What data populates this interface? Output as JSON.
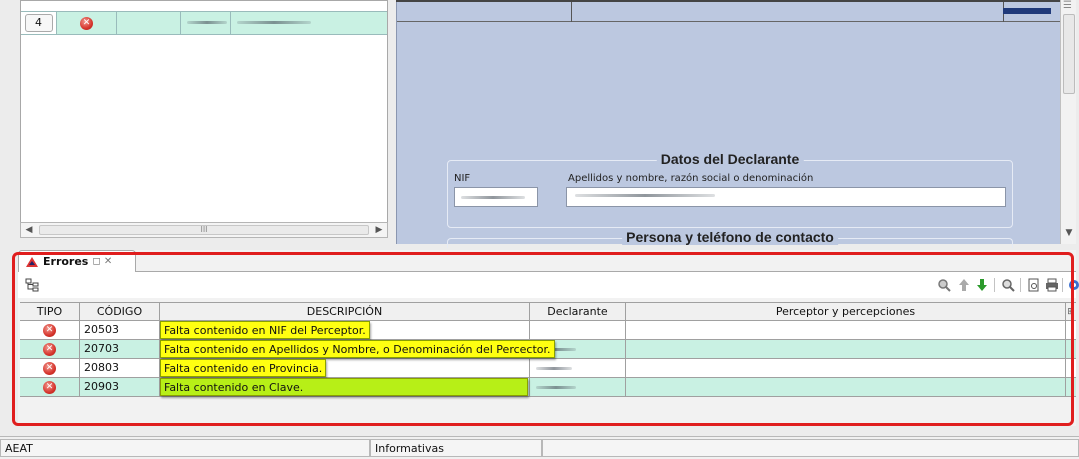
{
  "left_table": {
    "row_number": "4",
    "row_icon": "error-circle-icon",
    "hscroll_glyph": "III",
    "left_arrow": "◀",
    "right_arrow": "▶"
  },
  "form": {
    "section_title": "Datos del Declarante",
    "nif_label": "NIF",
    "name_label": "Apellidos y nombre, razón social o denominación",
    "next_section_title": "Persona y teléfono de contacto"
  },
  "errors_panel": {
    "tab_label": "Errores",
    "tab_extra": "◻ ✕",
    "tree_icon": "tree-icon",
    "toolbar_icons": [
      "search-icon",
      "arrow-up-icon",
      "arrow-down-icon",
      "zoom-icon",
      "preview-icon",
      "print-icon",
      "help-icon"
    ],
    "columns": [
      "TIPO",
      "CÓDIGO",
      "DESCRIPCIÓN",
      "Declarante",
      "Perceptor y percepciones"
    ],
    "rows": [
      {
        "codigo": "20503",
        "descripcion": "Falta contenido en NIF del Perceptor.",
        "highlight": "yellow"
      },
      {
        "codigo": "20703",
        "descripcion": "Falta contenido en Apellidos y Nombre, o Denominación del Percector.",
        "highlight": "yellow"
      },
      {
        "codigo": "20803",
        "descripcion": "Falta contenido en Provincia.",
        "highlight": "yellow"
      },
      {
        "codigo": "20903",
        "descripcion": "Falta contenido en Clave.",
        "highlight": "green"
      }
    ],
    "highlight_colors": {
      "yellow": "#ffff11",
      "green": "#b7ef17"
    },
    "frame_color": "#e01e1e"
  },
  "statusbar": {
    "left": "AEAT",
    "center": "Informativas"
  }
}
